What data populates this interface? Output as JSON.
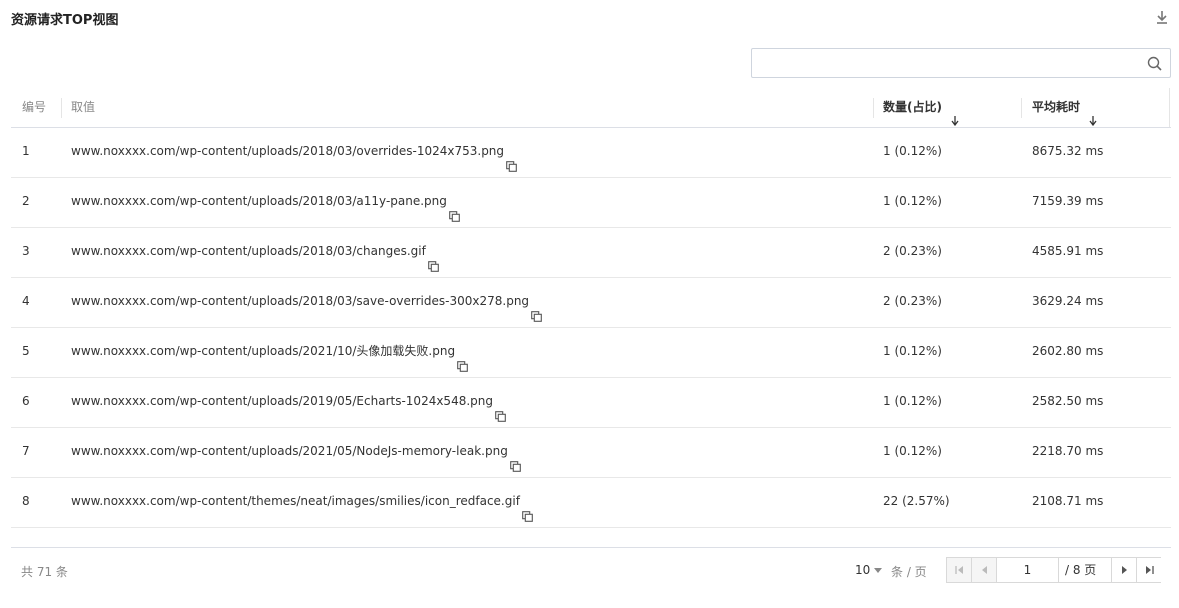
{
  "title": "资源请求TOP视图",
  "search": {
    "value": "",
    "placeholder": ""
  },
  "table": {
    "columns": {
      "index": "编号",
      "value": "取值",
      "count": "数量(占比)",
      "avg_time": "平均耗时"
    },
    "rows": [
      {
        "index": "1",
        "value": "www.noxxxx.com/wp-content/uploads/2018/03/overrides-1024x753.png",
        "count": "1 (0.12%)",
        "avg_time": "8675.32 ms"
      },
      {
        "index": "2",
        "value": "www.noxxxx.com/wp-content/uploads/2018/03/a11y-pane.png",
        "count": "1 (0.12%)",
        "avg_time": "7159.39 ms"
      },
      {
        "index": "3",
        "value": "www.noxxxx.com/wp-content/uploads/2018/03/changes.gif",
        "count": "2 (0.23%)",
        "avg_time": "4585.91 ms"
      },
      {
        "index": "4",
        "value": "www.noxxxx.com/wp-content/uploads/2018/03/save-overrides-300x278.png",
        "count": "2 (0.23%)",
        "avg_time": "3629.24 ms"
      },
      {
        "index": "5",
        "value": "www.noxxxx.com/wp-content/uploads/2021/10/头像加载失败.png",
        "count": "1 (0.12%)",
        "avg_time": "2602.80 ms"
      },
      {
        "index": "6",
        "value": "www.noxxxx.com/wp-content/uploads/2019/05/Echarts-1024x548.png",
        "count": "1 (0.12%)",
        "avg_time": "2582.50 ms"
      },
      {
        "index": "7",
        "value": "www.noxxxx.com/wp-content/uploads/2021/05/NodeJs-memory-leak.png",
        "count": "1 (0.12%)",
        "avg_time": "2218.70 ms"
      },
      {
        "index": "8",
        "value": "www.noxxxx.com/wp-content/themes/neat/images/smilies/icon_redface.gif",
        "count": "22 (2.57%)",
        "avg_time": "2108.71 ms"
      }
    ]
  },
  "footer": {
    "total": "共 71 条",
    "page_size": "10",
    "per_page_label": "条 / 页",
    "current_page": "1",
    "total_pages": "/ 8 页"
  },
  "icons": [
    "download-icon",
    "search-icon",
    "sort-down-icon",
    "copy-icon",
    "first-page-icon",
    "prev-page-icon",
    "next-page-icon",
    "last-page-icon"
  ]
}
